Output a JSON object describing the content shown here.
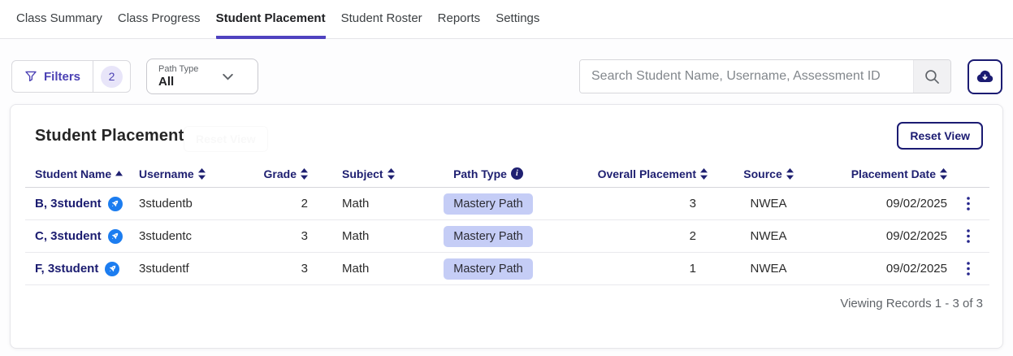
{
  "tabs": {
    "items": [
      {
        "label": "Class Summary"
      },
      {
        "label": "Class Progress"
      },
      {
        "label": "Student Placement"
      },
      {
        "label": "Student Roster"
      },
      {
        "label": "Reports"
      },
      {
        "label": "Settings"
      }
    ],
    "active": "Student Placement"
  },
  "toolbar": {
    "filters_label": "Filters",
    "filters_count": "2",
    "path_type_label": "Path Type",
    "path_type_value": "All",
    "search_placeholder": "Search Student Name, Username, Assessment ID"
  },
  "panel": {
    "title": "Student Placement",
    "reset_view_label": "Reset View",
    "footer": "Viewing Records 1 - 3 of 3"
  },
  "table": {
    "headers": {
      "student_name": "Student Name",
      "username": "Username",
      "grade": "Grade",
      "subject": "Subject",
      "path_type": "Path Type",
      "overall_placement": "Overall Placement",
      "source": "Source",
      "placement_date": "Placement Date"
    },
    "sort": {
      "column": "Student Name",
      "direction": "ascending"
    },
    "rows": [
      {
        "student_name": "B, 3student",
        "username": "3studentb",
        "grade": "2",
        "subject": "Math",
        "path_type": "Mastery Path",
        "overall_placement": "3",
        "source": "NWEA",
        "placement_date": "09/02/2025"
      },
      {
        "student_name": "C, 3student",
        "username": "3studentc",
        "grade": "3",
        "subject": "Math",
        "path_type": "Mastery Path",
        "overall_placement": "2",
        "source": "NWEA",
        "placement_date": "09/02/2025"
      },
      {
        "student_name": "F, 3student",
        "username": "3studentf",
        "grade": "3",
        "subject": "Math",
        "path_type": "Mastery Path",
        "overall_placement": "1",
        "source": "NWEA",
        "placement_date": "09/02/2025"
      }
    ]
  },
  "colors": {
    "accent_indigo": "#4f42c0",
    "navy": "#1b1b72",
    "badge_bg": "#c5cdf6",
    "blue_icon": "#1c7df0"
  }
}
